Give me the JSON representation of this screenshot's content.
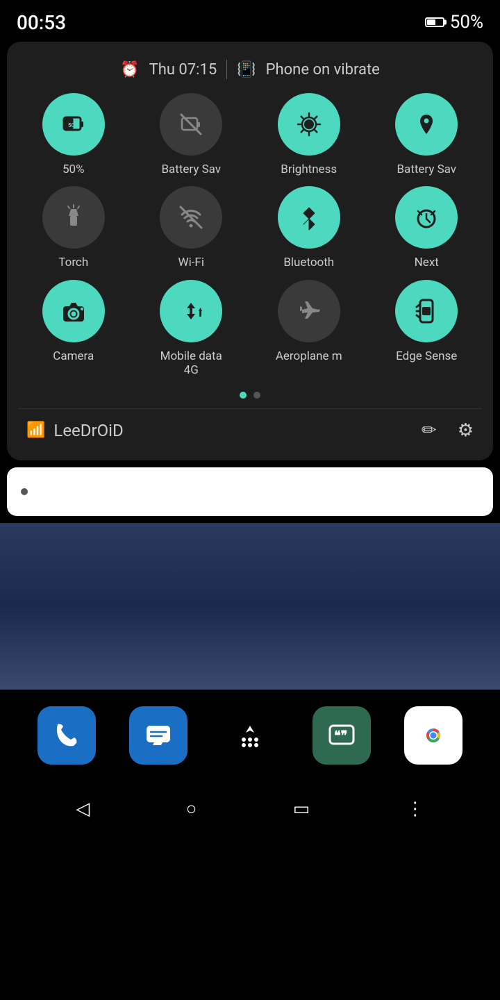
{
  "status_bar": {
    "time": "00:53",
    "battery_percent": "50%"
  },
  "qs_panel": {
    "header": {
      "day_time": "Thu 07:15",
      "vibrate_label": "Phone on vibrate"
    },
    "tiles_row1": [
      {
        "id": "battery-percent",
        "label": "50%",
        "state": "active",
        "icon": "battery"
      },
      {
        "id": "battery-saver-off",
        "label": "Battery Sav",
        "state": "inactive",
        "icon": "battery-saver-off"
      },
      {
        "id": "brightness",
        "label": "Brightness",
        "state": "active",
        "icon": "brightness"
      },
      {
        "id": "battery-saver2",
        "label": "Battery Sav",
        "state": "active",
        "icon": "location"
      }
    ],
    "tiles_row2": [
      {
        "id": "torch",
        "label": "Torch",
        "state": "inactive",
        "icon": "torch"
      },
      {
        "id": "wifi",
        "label": "Wi-Fi",
        "state": "inactive",
        "icon": "wifi-off"
      },
      {
        "id": "bluetooth",
        "label": "Bluetooth",
        "state": "active",
        "icon": "bluetooth"
      },
      {
        "id": "next",
        "label": "Next",
        "state": "active",
        "icon": "alarm"
      }
    ],
    "tiles_row3": [
      {
        "id": "camera",
        "label": "Camera",
        "state": "active",
        "icon": "camera"
      },
      {
        "id": "mobile-data",
        "label": "Mobile data\n4G",
        "state": "active",
        "icon": "data"
      },
      {
        "id": "aeroplane",
        "label": "Aeroplane m",
        "state": "inactive",
        "icon": "plane"
      },
      {
        "id": "edge-sense",
        "label": "Edge Sense",
        "state": "active",
        "icon": "edge"
      }
    ],
    "page_dots": [
      "active",
      "inactive"
    ],
    "footer": {
      "user_name": "LeeDrOiD",
      "edit_icon": "✏",
      "settings_icon": "⚙"
    }
  },
  "search_bar": {
    "placeholder": ""
  },
  "dock": {
    "apps": [
      {
        "id": "phone",
        "icon": "📞",
        "style": "dock-phone"
      },
      {
        "id": "messages",
        "icon": "💬",
        "style": "dock-messages"
      },
      {
        "id": "app-drawer",
        "icon": "⠿",
        "style": "dock-apps"
      },
      {
        "id": "quotes",
        "icon": "❝❞",
        "style": "dock-quotes"
      },
      {
        "id": "chrome",
        "icon": "◎",
        "style": "dock-chrome"
      }
    ]
  },
  "nav_bar": {
    "back_icon": "◁",
    "home_icon": "○",
    "recents_icon": "▭",
    "more_icon": "⋮"
  }
}
